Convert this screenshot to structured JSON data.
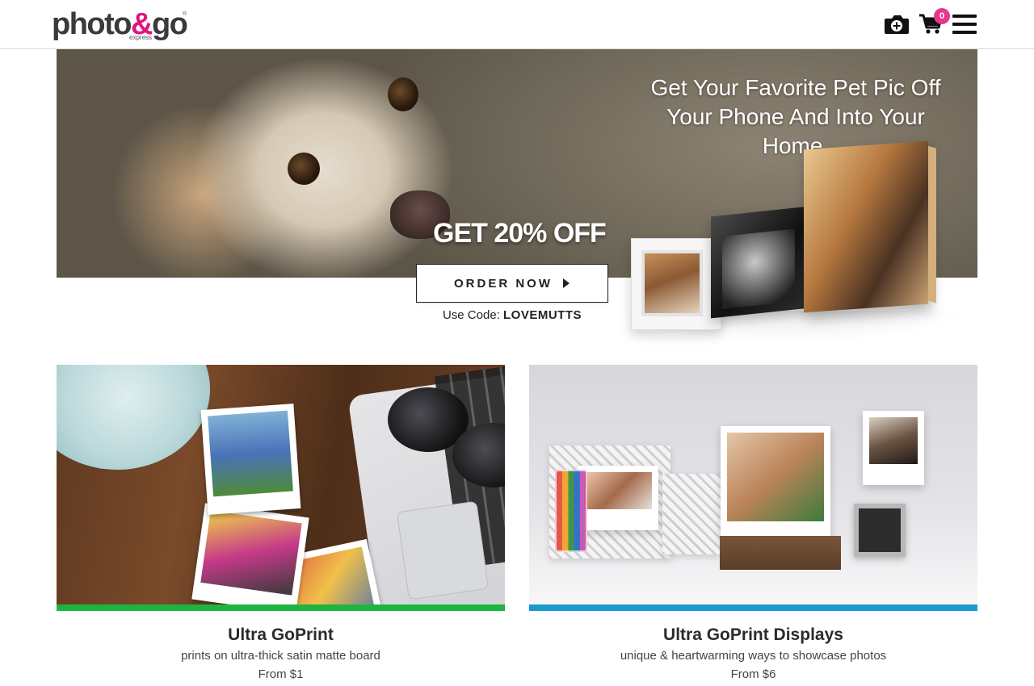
{
  "header": {
    "logo_text": "photo",
    "logo_amp": "&",
    "logo_text2": "go",
    "logo_sub": "express",
    "logo_reg": "®",
    "cart_count": "0",
    "icons": [
      "camera-plus-icon",
      "cart-icon",
      "menu-icon"
    ]
  },
  "hero": {
    "headline_1": "Get Your Favorite Pet Pic Off",
    "headline_2": "Your Phone And Into Your Home.",
    "promo": "GET 20% OFF",
    "cta_label": "ORDER NOW",
    "code_prefix": "Use Code:",
    "code": "LOVEMUTTS"
  },
  "cards": [
    {
      "title": "Ultra GoPrint",
      "description": "prints on ultra-thick satin matte board",
      "price": "From $1",
      "accent": "#1db53f"
    },
    {
      "title": "Ultra GoPrint Displays",
      "description": "unique & heartwarming ways to showcase photos",
      "price": "From $6",
      "accent": "#1b9ad0"
    }
  ]
}
